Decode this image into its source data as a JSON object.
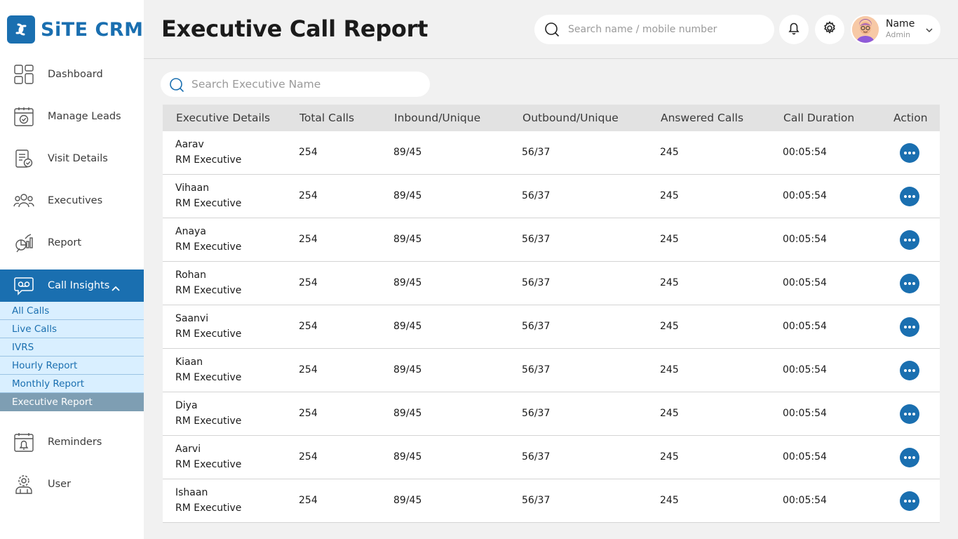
{
  "app": {
    "logo_text": "SiTE CRM",
    "brand_color": "#1a6fb0"
  },
  "sidebar": {
    "items": [
      {
        "label": "Dashboard",
        "icon": "dashboard-grid-icon"
      },
      {
        "label": "Manage Leads",
        "icon": "calendar-check-icon"
      },
      {
        "label": "Visit Details",
        "icon": "clipboard-check-icon"
      },
      {
        "label": "Executives",
        "icon": "users-group-icon"
      },
      {
        "label": "Report",
        "icon": "report-chart-icon"
      },
      {
        "label": "Call Insights",
        "icon": "voicemail-chat-icon",
        "active": true,
        "expanded": true
      },
      {
        "label": "Reminders",
        "icon": "calendar-bell-icon"
      },
      {
        "label": "User",
        "icon": "user-gear-icon"
      }
    ],
    "submenu": [
      {
        "label": "All Calls"
      },
      {
        "label": "Live Calls"
      },
      {
        "label": "IVRS"
      },
      {
        "label": "Hourly Report"
      },
      {
        "label": "Monthly Report"
      },
      {
        "label": "Executive Report",
        "active": true
      }
    ]
  },
  "header": {
    "title": "Executive Call Report",
    "search_placeholder": "Search name / mobile number",
    "profile": {
      "name": "Name",
      "role": "Admin"
    }
  },
  "main": {
    "search_placeholder": "Search Executive Name",
    "columns": [
      "Executive Details",
      "Total Calls",
      "Inbound/Unique",
      "Outbound/Unique",
      "Answered Calls",
      "Call Duration",
      "Action"
    ],
    "rows": [
      {
        "name": "Aarav",
        "role": "RM Executive",
        "total": "254",
        "inbound": "89/45",
        "outbound": "56/37",
        "answered": "245",
        "duration": "00:05:54"
      },
      {
        "name": "Vihaan",
        "role": "RM Executive",
        "total": "254",
        "inbound": "89/45",
        "outbound": "56/37",
        "answered": "245",
        "duration": "00:05:54"
      },
      {
        "name": "Anaya",
        "role": "RM Executive",
        "total": "254",
        "inbound": "89/45",
        "outbound": "56/37",
        "answered": "245",
        "duration": "00:05:54"
      },
      {
        "name": "Rohan",
        "role": "RM Executive",
        "total": "254",
        "inbound": "89/45",
        "outbound": "56/37",
        "answered": "245",
        "duration": "00:05:54"
      },
      {
        "name": "Saanvi",
        "role": "RM Executive",
        "total": "254",
        "inbound": "89/45",
        "outbound": "56/37",
        "answered": "245",
        "duration": "00:05:54"
      },
      {
        "name": "Kiaan",
        "role": "RM Executive",
        "total": "254",
        "inbound": "89/45",
        "outbound": "56/37",
        "answered": "245",
        "duration": "00:05:54"
      },
      {
        "name": "Diya",
        "role": "RM Executive",
        "total": "254",
        "inbound": "89/45",
        "outbound": "56/37",
        "answered": "245",
        "duration": "00:05:54"
      },
      {
        "name": "Aarvi",
        "role": "RM Executive",
        "total": "254",
        "inbound": "89/45",
        "outbound": "56/37",
        "answered": "245",
        "duration": "00:05:54"
      },
      {
        "name": "Ishaan",
        "role": "RM Executive",
        "total": "254",
        "inbound": "89/45",
        "outbound": "56/37",
        "answered": "245",
        "duration": "00:05:54"
      }
    ]
  }
}
